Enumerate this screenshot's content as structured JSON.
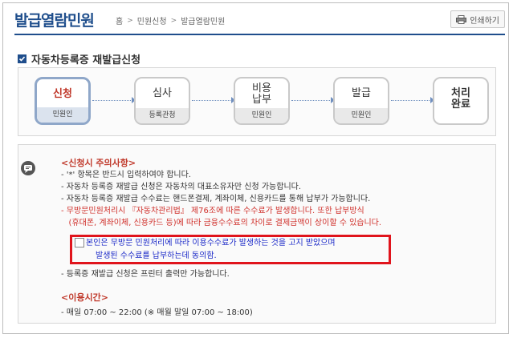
{
  "header": {
    "title": "발급열람민원",
    "breadcrumb": [
      "홈",
      "민원신청",
      "발급열람민원"
    ],
    "print_label": "인쇄하기"
  },
  "section": {
    "title": "자동차등록증 재발급신청"
  },
  "steps": [
    {
      "label": "신청",
      "sub": "민원인",
      "active": true
    },
    {
      "label": "심사",
      "sub": "등록관청",
      "active": false
    },
    {
      "label": "비용\n납부",
      "sub": "민원인",
      "active": false
    },
    {
      "label": "발급",
      "sub": "민원인",
      "active": false
    },
    {
      "label": "처리\n완료",
      "sub": "",
      "active": false
    }
  ],
  "notice": {
    "heading": "<신청시 주의사항>",
    "lines": [
      {
        "text": "- '*' 항목은 반드시 입력하여야 합니다.",
        "color": "normal"
      },
      {
        "text": "- 자동차 등록증 재발급 신청은 자동차의 대표소유자만 신청 가능합니다.",
        "color": "normal"
      },
      {
        "text": "- 자동차 등록증 재발급 수수료는 핸드폰결제, 계좌이체, 신용카드를 통해 납부가 가능합니다.",
        "color": "normal"
      },
      {
        "text": "- 무방문민원처리시 『자동차관리법』 제76조에 따른 수수료가 발생합니다. 또한 납부방식",
        "color": "red"
      },
      {
        "text": "   (휴대폰, 계좌이체, 신용카드 등)에 따라 금융수수료의 차이로 결제금액이 상이할 수 있습니다.",
        "color": "red"
      }
    ],
    "consent_line1": "본인은 무방문 민원처리에 따라 이용수수료가 발생하는 것을 고지 받았으며",
    "consent_line2": "발생된 수수료를 납부하는데 동의함.",
    "after_consent": "- 등록증 재발급 신청은 프린터 출력만 가능합니다.",
    "hours_heading": "<이용시간>",
    "hours_line": "- 매일 07:00 ~ 22:00 (※ 매월 말일 07:00 ~ 18:00)"
  },
  "colors": {
    "accent": "#1f4e8c",
    "warning": "#d0302b",
    "consent_border": "#e0141c",
    "consent_text": "#1a28c8"
  }
}
